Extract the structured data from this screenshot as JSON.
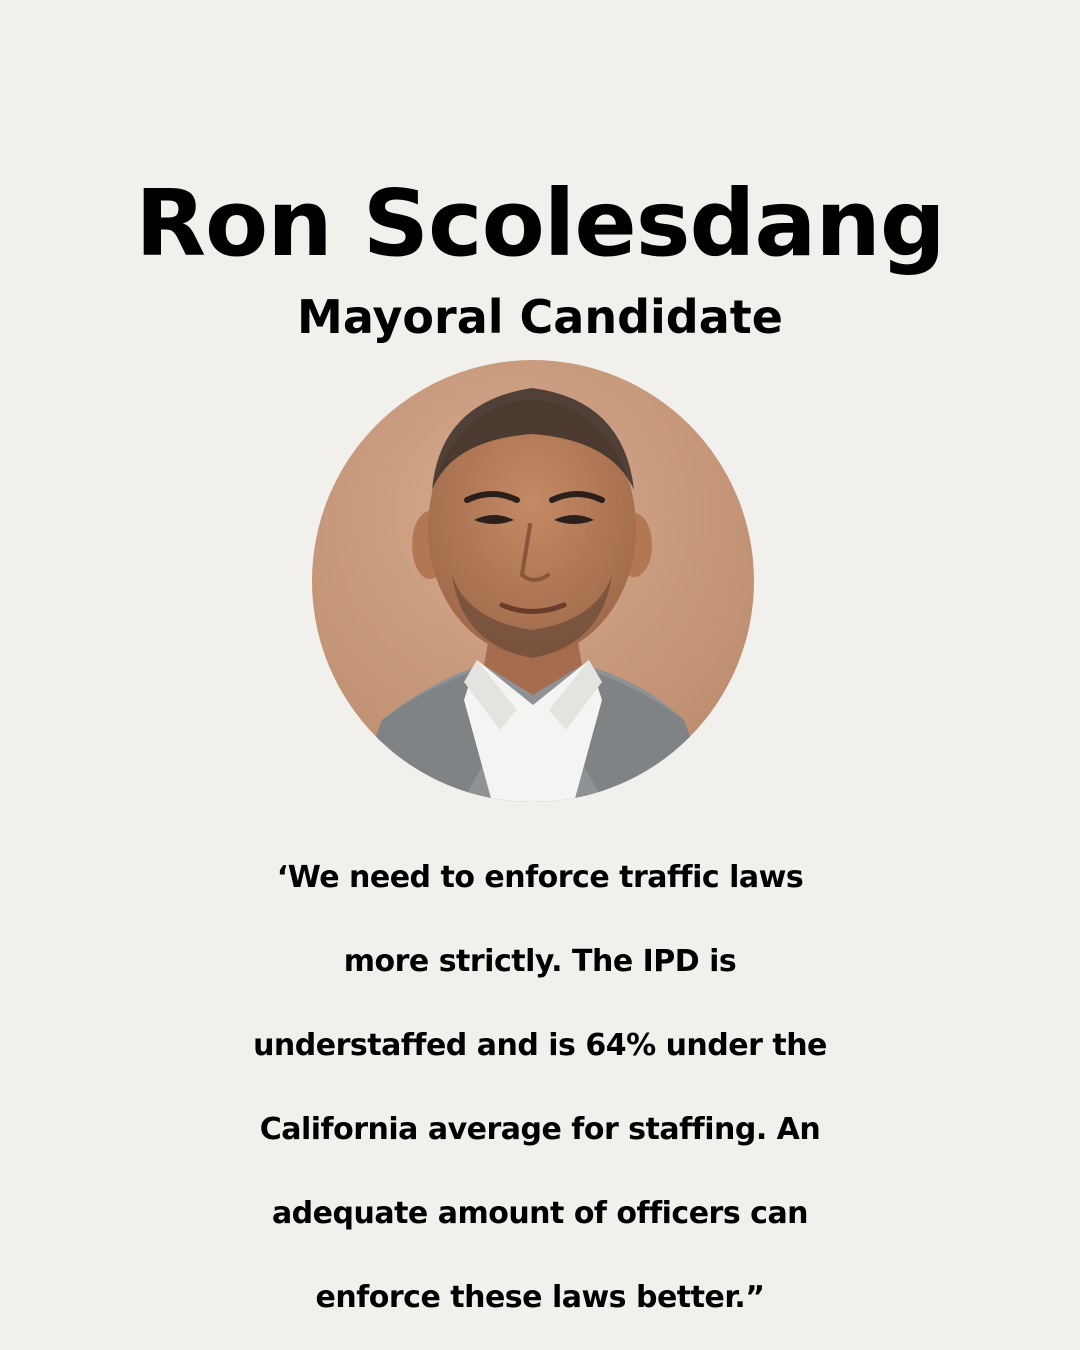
{
  "header": {
    "name": "Ron Scolesdang",
    "role": "Mayoral Candidate"
  },
  "photo": {
    "subject": "portrait-photo",
    "background_color": "#c89a7f",
    "jacket_color": "#8d9193",
    "shirt_color": "#f4f4f2",
    "skin_color": "#b97c5a"
  },
  "quote": {
    "lines": [
      "‘We need to enforce traffic laws",
      "more strictly. The IPD is",
      "understaffed and is 64% under the",
      "California average for staffing. An",
      "adequate amount of officers can",
      "enforce these laws better.”"
    ]
  }
}
